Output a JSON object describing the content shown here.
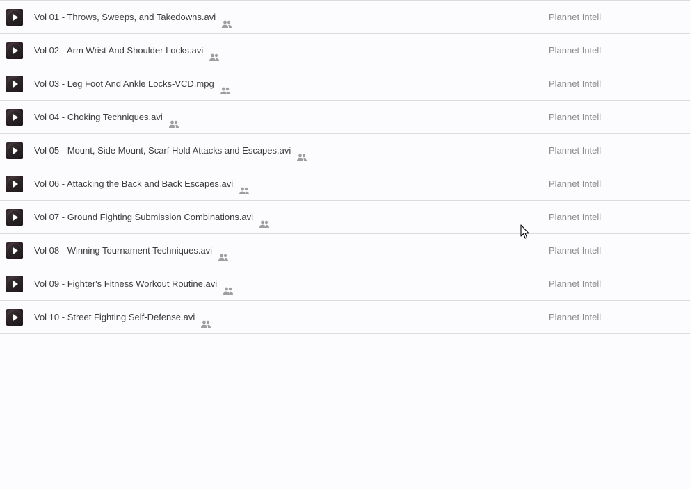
{
  "files": [
    {
      "name": "Vol 01 - Throws, Sweeps, and Takedowns.avi",
      "owner": "Plannet Intell"
    },
    {
      "name": "Vol 02 - Arm Wrist And Shoulder Locks.avi",
      "owner": "Plannet Intell"
    },
    {
      "name": "Vol 03 - Leg Foot And Ankle Locks-VCD.mpg",
      "owner": "Plannet Intell"
    },
    {
      "name": "Vol 04 - Choking Techniques.avi",
      "owner": "Plannet Intell"
    },
    {
      "name": "Vol 05 - Mount, Side Mount, Scarf Hold Attacks and Escapes.avi",
      "owner": "Plannet Intell"
    },
    {
      "name": "Vol 06 - Attacking the Back and Back Escapes.avi",
      "owner": "Plannet Intell"
    },
    {
      "name": "Vol 07 - Ground Fighting Submission Combinations.avi",
      "owner": "Plannet Intell"
    },
    {
      "name": "Vol 08 - Winning Tournament Techniques.avi",
      "owner": "Plannet Intell"
    },
    {
      "name": "Vol 09 - Fighter's Fitness Workout Routine.avi",
      "owner": "Plannet Intell"
    },
    {
      "name": "Vol 10 - Street Fighting Self-Defense.avi",
      "owner": "Plannet Intell"
    }
  ],
  "icons": {
    "thumbnail": "video-play-thumbnail-icon",
    "shared": "shared-people-icon",
    "cursor": "mouse-cursor-icon"
  },
  "colors": {
    "background": "#fcfbfd",
    "divider": "#dcdcdc",
    "name_text": "#3c3c3c",
    "owner_text": "#8a8a8a",
    "shared_icon": "#9e9e9e"
  }
}
